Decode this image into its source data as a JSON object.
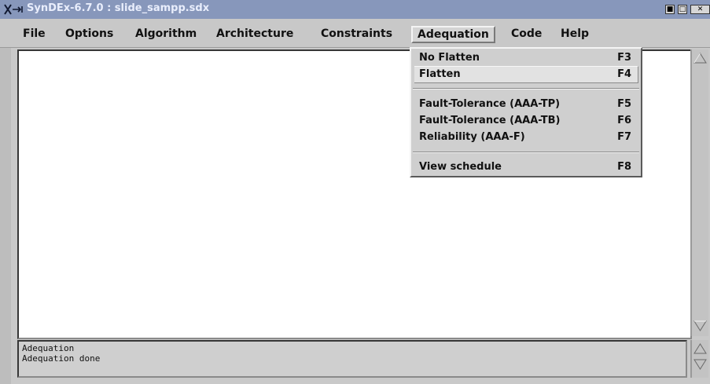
{
  "window": {
    "title": "SynDEx-6.7.0 : slide_sampp.sdx",
    "app_icon": "x-arrow-icon",
    "controls": [
      "minimize-icon",
      "maximize-icon",
      "close-icon"
    ]
  },
  "menubar": {
    "items": [
      {
        "label": "File"
      },
      {
        "label": "Options"
      },
      {
        "label": "Algorithm"
      },
      {
        "label": "Architecture"
      },
      {
        "label": "Constraints"
      },
      {
        "label": "Adequation"
      },
      {
        "label": "Code"
      },
      {
        "label": "Help"
      }
    ],
    "active": "Adequation"
  },
  "adequation_menu": {
    "items": [
      {
        "label": "No Flatten",
        "shortcut": "F3"
      },
      {
        "label": "Flatten",
        "shortcut": "F4"
      },
      {
        "label": "Fault-Tolerance (AAA-TP)",
        "shortcut": "F5"
      },
      {
        "label": "Fault-Tolerance (AAA-TB)",
        "shortcut": "F6"
      },
      {
        "label": "Reliability (AAA-F)",
        "shortcut": "F7"
      },
      {
        "label": "View schedule",
        "shortcut": "F8"
      }
    ],
    "highlighted": "Flatten"
  },
  "log": {
    "lines": [
      "Adequation",
      "Adequation done"
    ]
  },
  "colors": {
    "titlebar": "#7f8fb3",
    "window_bg": "#c9c9c9",
    "canvas_bg": "#ffffff"
  }
}
